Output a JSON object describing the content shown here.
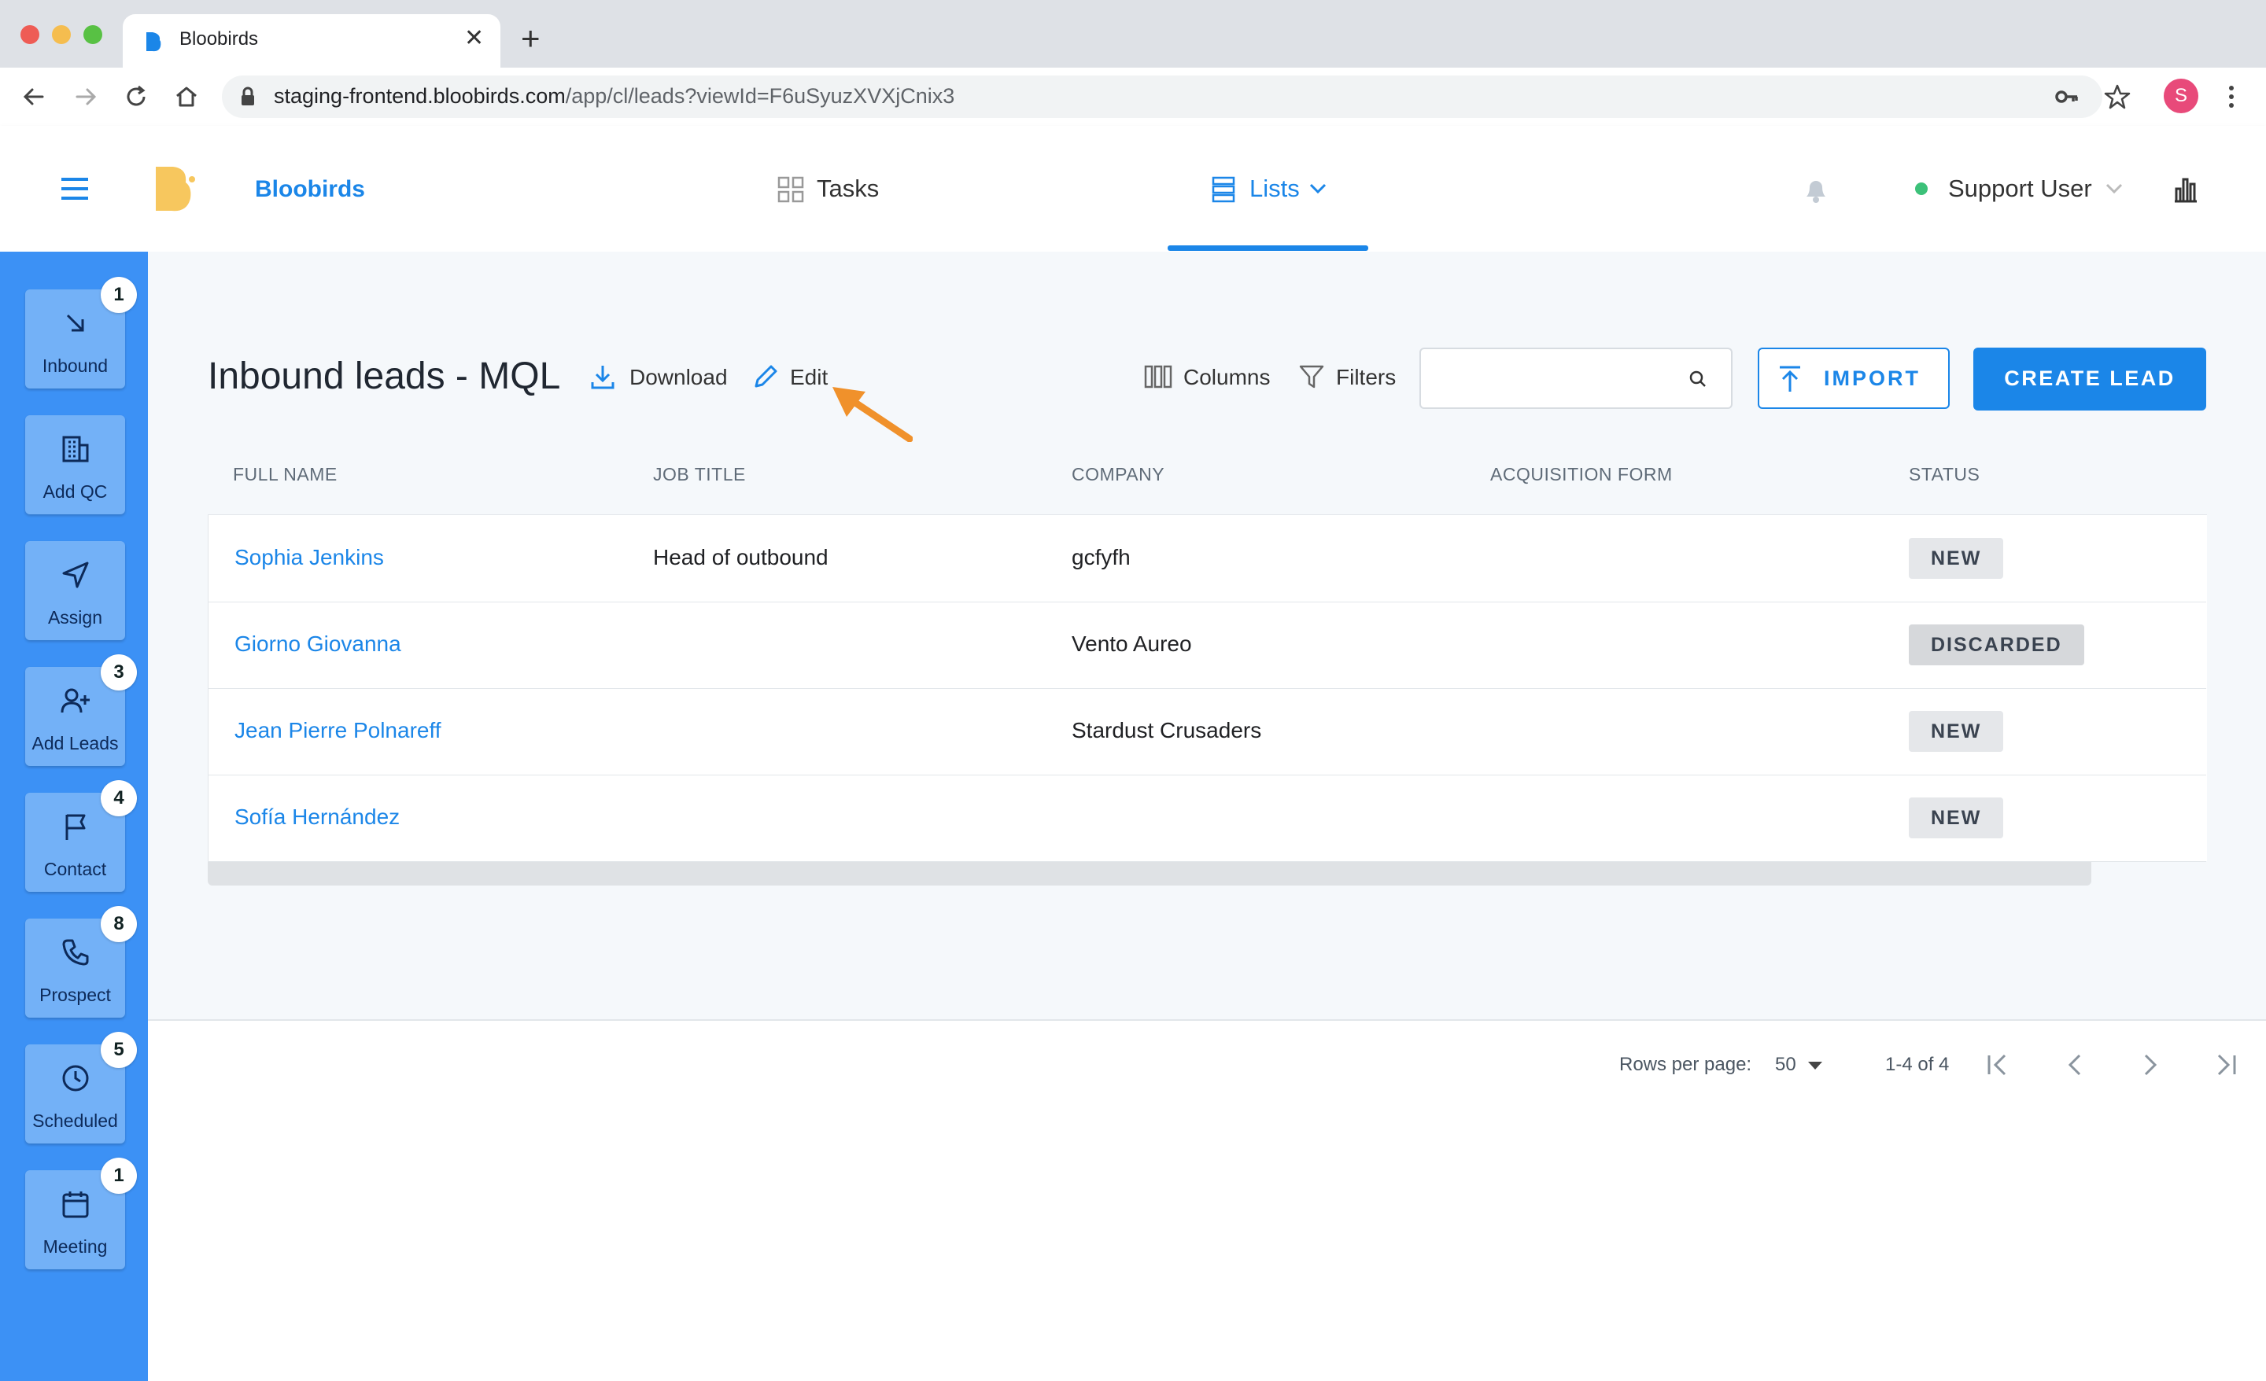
{
  "browser": {
    "tab_title": "Bloobirds",
    "url_domain": "staging-frontend.bloobirds.com",
    "url_path": "/app/cl/leads?viewId=F6uSyuzXVXjCnix3",
    "profile_initial": "S",
    "icons": [
      "back-icon",
      "forward-icon",
      "reload-icon",
      "home-icon",
      "lock-icon",
      "key-icon",
      "star-icon",
      "menu-dots-icon"
    ]
  },
  "header": {
    "brand": "Bloobirds",
    "nav": {
      "tasks": "Tasks",
      "lists": "Lists"
    },
    "user": "Support User"
  },
  "sidebar": {
    "items": [
      {
        "label": "Inbound",
        "badge": "1",
        "icon": "arrow-down-right-icon"
      },
      {
        "label": "Add QC",
        "badge": null,
        "icon": "building-icon"
      },
      {
        "label": "Assign",
        "badge": null,
        "icon": "send-icon"
      },
      {
        "label": "Add Leads",
        "badge": "3",
        "icon": "add-user-icon"
      },
      {
        "label": "Contact",
        "badge": "4",
        "icon": "flag-icon"
      },
      {
        "label": "Prospect",
        "badge": "8",
        "icon": "phone-icon"
      },
      {
        "label": "Scheduled",
        "badge": "5",
        "icon": "clock-icon"
      },
      {
        "label": "Meeting",
        "badge": "1",
        "icon": "calendar-icon"
      }
    ]
  },
  "main": {
    "title": "Inbound leads - MQL",
    "download": "Download",
    "edit": "Edit",
    "columns": "Columns",
    "filters": "Filters",
    "search_placeholder": "",
    "import": "IMPORT",
    "create_lead": "CREATE LEAD",
    "table": {
      "headers": [
        "FULL NAME",
        "JOB TITLE",
        "COMPANY",
        "ACQUISITION FORM",
        "STATUS"
      ],
      "rows": [
        {
          "name": "Sophia Jenkins",
          "job": "Head of outbound",
          "company": "gcfyfh",
          "form": "",
          "status": "NEW"
        },
        {
          "name": "Giorno Giovanna",
          "job": "",
          "company": "Vento Aureo",
          "form": "",
          "status": "DISCARDED"
        },
        {
          "name": "Jean Pierre Polnareff",
          "job": "",
          "company": "Stardust Crusaders",
          "form": "",
          "status": "NEW"
        },
        {
          "name": "Sofía Hernández",
          "job": "",
          "company": "",
          "form": "",
          "status": "NEW"
        }
      ]
    }
  },
  "pagination": {
    "rows_per_page_label": "Rows per page:",
    "rows_per_page": "50",
    "range": "1-4 of 4"
  },
  "colors": {
    "accent": "#1b86e8",
    "sidebar": "#3c91f5",
    "annotation_arrow": "#f0912b"
  }
}
